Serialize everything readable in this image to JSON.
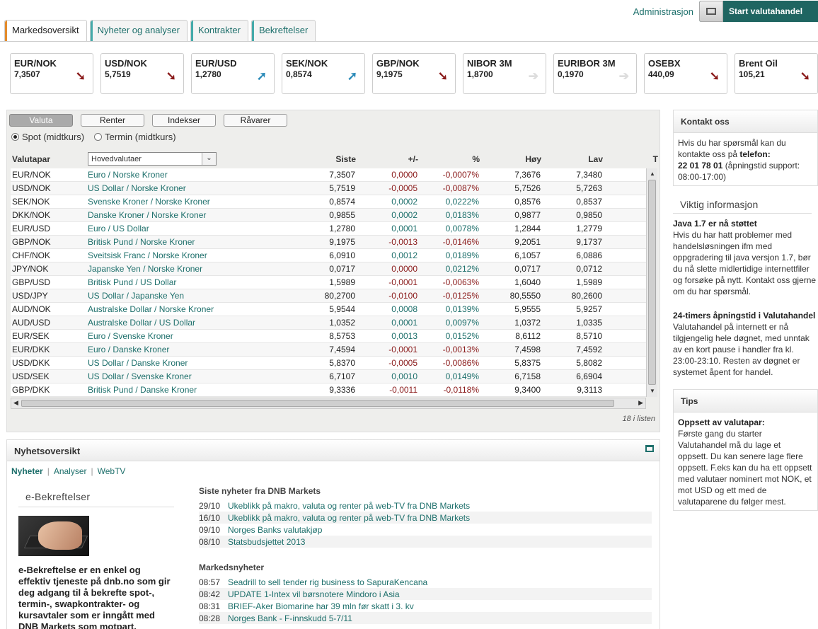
{
  "topbar": {
    "admin": "Administrasjon",
    "trade": "Start valutahandel"
  },
  "tabs": [
    {
      "label": "Markedsoversikt"
    },
    {
      "label": "Nyheter og analyser"
    },
    {
      "label": "Kontrakter"
    },
    {
      "label": "Bekreftelser"
    }
  ],
  "tickers": [
    {
      "name": "EUR/NOK",
      "value": "7,3507",
      "trend": "down"
    },
    {
      "name": "USD/NOK",
      "value": "5,7519",
      "trend": "down"
    },
    {
      "name": "EUR/USD",
      "value": "1,2780",
      "trend": "up"
    },
    {
      "name": "SEK/NOK",
      "value": "0,8574",
      "trend": "up"
    },
    {
      "name": "GBP/NOK",
      "value": "9,1975",
      "trend": "down"
    },
    {
      "name": "NIBOR 3M",
      "value": "1,8700",
      "trend": "flat"
    },
    {
      "name": "EURIBOR 3M",
      "value": "0,1970",
      "trend": "flat"
    },
    {
      "name": "OSEBX",
      "value": "440,09",
      "trend": "down"
    },
    {
      "name": "Brent Oil",
      "value": "105,21",
      "trend": "down"
    }
  ],
  "market": {
    "categories": [
      "Valuta",
      "Renter",
      "Indekser",
      "Råvarer"
    ],
    "radio": {
      "spot": "Spot (midtkurs)",
      "termin": "Termin (midtkurs)"
    },
    "headers": {
      "pair": "Valutapar",
      "last": "Siste",
      "chg": "+/-",
      "pct": "%",
      "high": "Høy",
      "low": "Lav",
      "extra": "T"
    },
    "filter": "Hovedvalutaer",
    "rows": [
      [
        "EUR/NOK",
        "Euro / Norske Kroner",
        "7,3507",
        "0,0000",
        "-0,0007%",
        "7,3676",
        "7,3480"
      ],
      [
        "USD/NOK",
        "US Dollar / Norske Kroner",
        "5,7519",
        "-0,0005",
        "-0,0087%",
        "5,7526",
        "5,7263"
      ],
      [
        "SEK/NOK",
        "Svenske Kroner / Norske Kroner",
        "0,8574",
        "0,0002",
        "0,0222%",
        "0,8576",
        "0,8537"
      ],
      [
        "DKK/NOK",
        "Danske Kroner / Norske Kroner",
        "0,9855",
        "0,0002",
        "0,0183%",
        "0,9877",
        "0,9850"
      ],
      [
        "EUR/USD",
        "Euro / US Dollar",
        "1,2780",
        "0,0001",
        "0,0078%",
        "1,2844",
        "1,2779"
      ],
      [
        "GBP/NOK",
        "Britisk Pund / Norske Kroner",
        "9,1975",
        "-0,0013",
        "-0,0146%",
        "9,2051",
        "9,1737"
      ],
      [
        "CHF/NOK",
        "Sveitsisk Franc / Norske Kroner",
        "6,0910",
        "0,0012",
        "0,0189%",
        "6,1057",
        "6,0886"
      ],
      [
        "JPY/NOK",
        "Japanske Yen / Norske Kroner",
        "0,0717",
        "0,0000",
        "0,0212%",
        "0,0717",
        "0,0712"
      ],
      [
        "GBP/USD",
        "Britisk Pund / US Dollar",
        "1,5989",
        "-0,0001",
        "-0,0063%",
        "1,6040",
        "1,5989"
      ],
      [
        "USD/JPY",
        "US Dollar / Japanske Yen",
        "80,2700",
        "-0,0100",
        "-0,0125%",
        "80,5550",
        "80,2600"
      ],
      [
        "AUD/NOK",
        "Australske Dollar / Norske Kroner",
        "5,9544",
        "0,0008",
        "0,0139%",
        "5,9555",
        "5,9257"
      ],
      [
        "AUD/USD",
        "Australske Dollar / US Dollar",
        "1,0352",
        "0,0001",
        "0,0097%",
        "1,0372",
        "1,0335"
      ],
      [
        "EUR/SEK",
        "Euro / Svenske Kroner",
        "8,5753",
        "0,0013",
        "0,0152%",
        "8,6112",
        "8,5710"
      ],
      [
        "EUR/DKK",
        "Euro / Danske Kroner",
        "7,4594",
        "-0,0001",
        "-0,0013%",
        "7,4598",
        "7,4592"
      ],
      [
        "USD/DKK",
        "US Dollar / Danske Kroner",
        "5,8370",
        "-0,0005",
        "-0,0086%",
        "5,8375",
        "5,8082"
      ],
      [
        "USD/SEK",
        "US Dollar / Svenske Kroner",
        "6,7107",
        "0,0010",
        "0,0149%",
        "6,7158",
        "6,6904"
      ],
      [
        "GBP/DKK",
        "Britisk Pund / Danske Kroner",
        "9,3336",
        "-0,0011",
        "-0,0118%",
        "9,3400",
        "9,3113"
      ]
    ],
    "count": "18 i listen"
  },
  "news": {
    "title": "Nyhetsoversikt",
    "tabs": [
      "Nyheter",
      "Analyser",
      "WebTV"
    ],
    "ebox": {
      "title": "e-Bekreftelser",
      "text": "e-Bekreftelse er en enkel og effektiv tjeneste på dnb.no som gir deg adgang til å bekrefte spot-, termin-, swapkontrakter- og kursavtaler som er inngått med DNB Markets som motpart."
    },
    "dnb_head": "Siste nyheter fra DNB Markets",
    "dnb": [
      [
        "29/10",
        "Ukeblikk på makro, valuta og renter på web-TV fra DNB Markets"
      ],
      [
        "16/10",
        "Ukeblikk på makro, valuta og renter på web-TV fra DNB Markets"
      ],
      [
        "09/10",
        "Norges Banks valutakjøp"
      ],
      [
        "08/10",
        "Statsbudsjettet 2013"
      ]
    ],
    "market_head": "Markedsnyheter",
    "market": [
      [
        "08:57",
        "Seadrill to sell tender rig business to SapuraKencana"
      ],
      [
        "08:42",
        "UPDATE 1-Intex vil børsnotere Mindoro i Asia"
      ],
      [
        "08:31",
        "BRIEF-Aker Biomarine har 39 mln før skatt i 3. kv"
      ],
      [
        "08:28",
        "Norges Bank - F-innskudd 5-7/11"
      ]
    ]
  },
  "sidebar": {
    "contact_title": "Kontakt oss",
    "contact_text1": "Hvis du har spørsmål kan du kontakte oss på ",
    "contact_bold1": "telefon:",
    "contact_phone": "22 01 78 01",
    "contact_text2": " (åpningstid support: 08:00-17:00)",
    "info_title": "Viktig informasjon",
    "java_head": "Java 1.7 er nå støttet",
    "java_text": "Hvis du har hatt problemer med handelsløsningen ifm med oppgradering til java versjon 1.7, bør du nå slette midlertidige internettfiler og forsøke på nytt. Kontakt oss gjerne om du har spørsmål.",
    "open_head": "24-timers åpningstid i Valutahandel",
    "open_text": "Valutahandel på internett er nå tilgjengelig hele døgnet, med unntak av en kort pause i handler fra kl. 23:00-23:10. Resten av døgnet er systemet åpent for handel.",
    "tips_title": "Tips",
    "tips_head": "Oppsett av valutapar:",
    "tips_text": "Første gang du starter Valutahandel må du lage et oppsett. Du kan senere lage flere oppsett. F.eks kan du ha ett oppsett med valutaer nominert mot NOK, et mot USD og ett med de valutaparene du følger mest."
  },
  "colors": {
    "accent": "#1d6f6b",
    "negative": "#8a1a1a",
    "up": "#2a8ab8",
    "tab_active": "#e38c2c"
  }
}
